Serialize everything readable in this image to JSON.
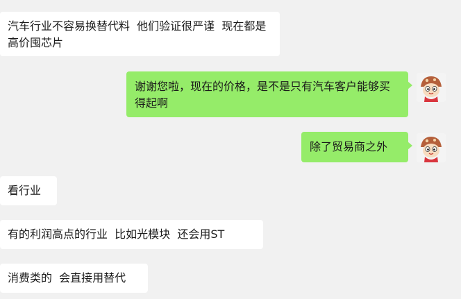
{
  "messages": [
    {
      "side": "in",
      "text": "汽车行业不容易换替代料  他们验证很严谨  现在都是高价囤芯片"
    },
    {
      "side": "out",
      "text": "谢谢您啦，现在的价格，是不是只有汽车客户能够买得起啊"
    },
    {
      "side": "out",
      "text": "除了贸易商之外"
    },
    {
      "side": "in",
      "text": "看行业"
    },
    {
      "side": "in",
      "text": "有的利润高点的行业  比如光模块  还会用ST"
    },
    {
      "side": "in",
      "text": "消费类的  会直接用替代"
    }
  ],
  "avatar": {
    "icon": "cartoon-kid-icon"
  },
  "colors": {
    "background": "#f1f1f1",
    "incoming_bubble": "#ffffff",
    "outgoing_bubble": "#95ec69"
  }
}
